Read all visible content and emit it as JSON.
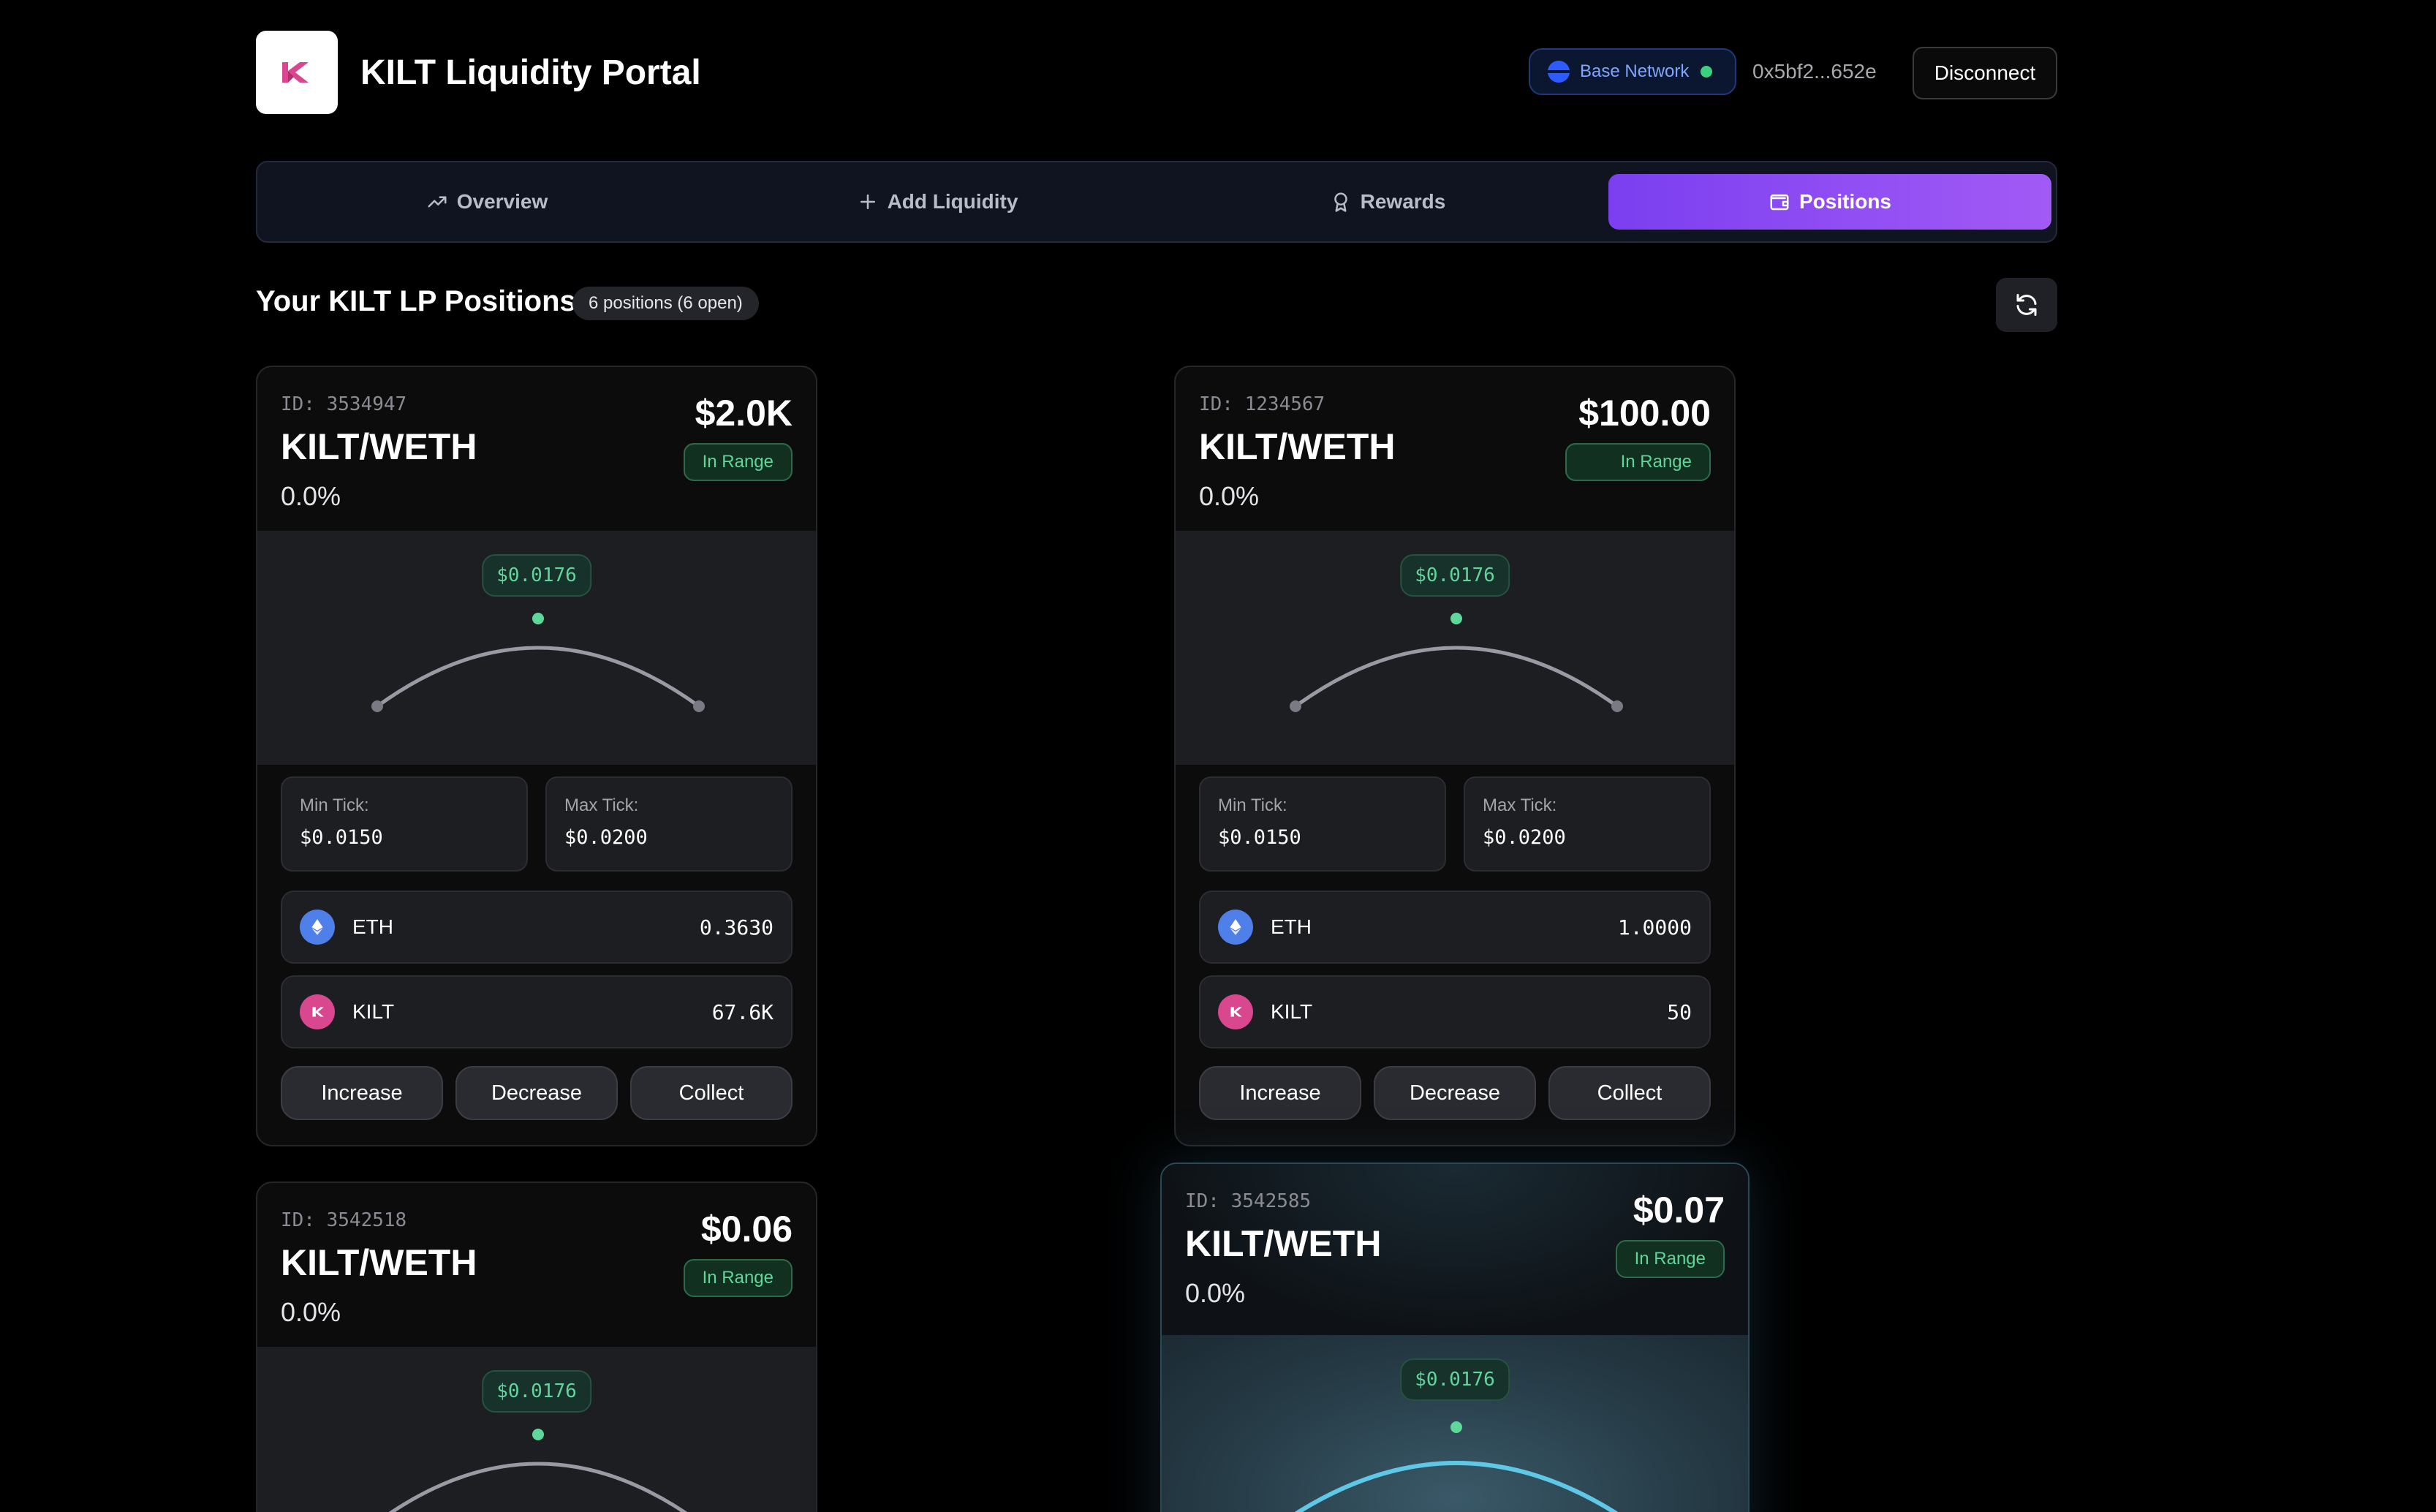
{
  "app": {
    "title": "KILT Liquidity Portal",
    "network": "Base Network",
    "wallet": "0x5bf2...652e",
    "disconnect_label": "Disconnect"
  },
  "tabs": [
    {
      "label": "Overview",
      "icon": "trending-up-icon",
      "active": false
    },
    {
      "label": "Add Liquidity",
      "icon": "plus-icon",
      "active": false
    },
    {
      "label": "Rewards",
      "icon": "award-icon",
      "active": false
    },
    {
      "label": "Positions",
      "icon": "wallet-icon",
      "active": true
    }
  ],
  "section": {
    "title": "Your KILT LP Positions",
    "badge": "6 positions (6 open)"
  },
  "labels": {
    "min_tick": "Min Tick:",
    "max_tick": "Max Tick:",
    "increase": "Increase",
    "decrease": "Decrease",
    "collect": "Collect"
  },
  "positions": [
    {
      "id": "ID: 3534947",
      "pair": "KILT/WETH",
      "pct": "0.0%",
      "value": "$2.0K",
      "status": "In Range",
      "current_price": "$0.0176",
      "min_tick": "$0.0150",
      "max_tick": "$0.0200",
      "tokens": [
        {
          "symbol": "ETH",
          "amount": "0.3630"
        },
        {
          "symbol": "KILT",
          "amount": "67.6K"
        }
      ]
    },
    {
      "id": "ID: 1234567",
      "pair": "KILT/WETH",
      "pct": "0.0%",
      "value": "$100.00",
      "status": "In Range",
      "current_price": "$0.0176",
      "min_tick": "$0.0150",
      "max_tick": "$0.0200",
      "tokens": [
        {
          "symbol": "ETH",
          "amount": "1.0000"
        },
        {
          "symbol": "KILT",
          "amount": "50"
        }
      ]
    },
    {
      "id": "ID: 3542518",
      "pair": "KILT/WETH",
      "pct": "0.0%",
      "value": "$0.06",
      "status": "In Range",
      "current_price": "$0.0176"
    },
    {
      "id": "ID: 3542585",
      "pair": "KILT/WETH",
      "pct": "0.0%",
      "value": "$0.07",
      "status": "In Range",
      "current_price": "$0.0176"
    }
  ],
  "colors": {
    "accent": "#8b4cf3",
    "in_range": "#5fd69a",
    "eth": "#4f7fe8",
    "kilt": "#d9488f"
  }
}
